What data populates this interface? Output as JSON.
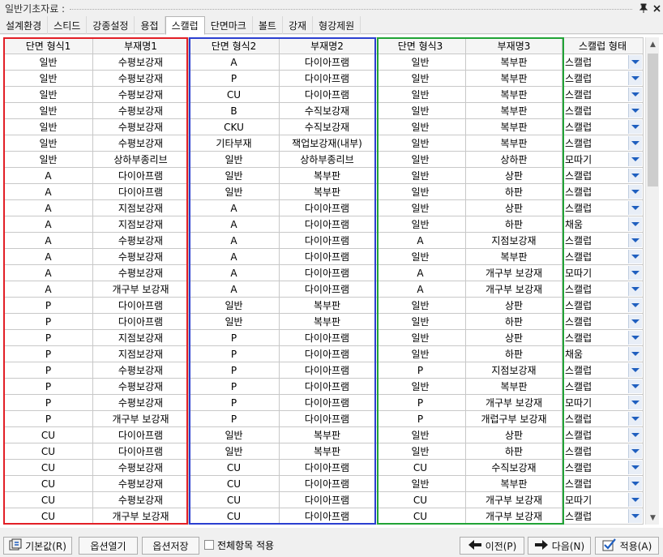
{
  "window": {
    "title": "일반기초자료 :"
  },
  "tabs": [
    "설계환경",
    "스티드",
    "강종설정",
    "용접",
    "스캘럽",
    "단면마크",
    "볼트",
    "강재",
    "형강제원"
  ],
  "active_tab_index": 4,
  "table": {
    "headers": [
      "단면 형식1",
      "부재명1",
      "단면 형식2",
      "부재명2",
      "단면 형식3",
      "부재명3",
      "스캘럽 형태"
    ],
    "rows": [
      [
        "일반",
        "수평보강재",
        "A",
        "다이아프램",
        "일반",
        "복부판",
        "스캘럽"
      ],
      [
        "일반",
        "수평보강재",
        "P",
        "다이아프램",
        "일반",
        "복부판",
        "스캘럽"
      ],
      [
        "일반",
        "수평보강재",
        "CU",
        "다이아프램",
        "일반",
        "복부판",
        "스캘럽"
      ],
      [
        "일반",
        "수평보강재",
        "B",
        "수직보강재",
        "일반",
        "복부판",
        "스캘럽"
      ],
      [
        "일반",
        "수평보강재",
        "CKU",
        "수직보강재",
        "일반",
        "복부판",
        "스캘럽"
      ],
      [
        "일반",
        "수평보강재",
        "기타부재",
        "잭업보강재(내부)",
        "일반",
        "복부판",
        "스캘럽"
      ],
      [
        "일반",
        "상하부종리브",
        "일반",
        "상하부종리브",
        "일반",
        "상하판",
        "모따기"
      ],
      [
        "A",
        "다이아프램",
        "일반",
        "복부판",
        "일반",
        "상판",
        "스캘럽"
      ],
      [
        "A",
        "다이아프램",
        "일반",
        "복부판",
        "일반",
        "하판",
        "스캘럽"
      ],
      [
        "A",
        "지점보강재",
        "A",
        "다이아프램",
        "일반",
        "상판",
        "스캘럽"
      ],
      [
        "A",
        "지점보강재",
        "A",
        "다이아프램",
        "일반",
        "하판",
        "채움"
      ],
      [
        "A",
        "수평보강재",
        "A",
        "다이아프램",
        "A",
        "지점보강재",
        "스캘럽"
      ],
      [
        "A",
        "수평보강재",
        "A",
        "다이아프램",
        "일반",
        "복부판",
        "스캘럽"
      ],
      [
        "A",
        "수평보강재",
        "A",
        "다이아프램",
        "A",
        "개구부 보강재",
        "모따기"
      ],
      [
        "A",
        "개구부 보강재",
        "A",
        "다이아프램",
        "A",
        "개구부 보강재",
        "스캘럽"
      ],
      [
        "P",
        "다이아프램",
        "일반",
        "복부판",
        "일반",
        "상판",
        "스캘럽"
      ],
      [
        "P",
        "다이아프램",
        "일반",
        "복부판",
        "일반",
        "하판",
        "스캘럽"
      ],
      [
        "P",
        "지점보강재",
        "P",
        "다이아프램",
        "일반",
        "상판",
        "스캘럽"
      ],
      [
        "P",
        "지점보강재",
        "P",
        "다이아프램",
        "일반",
        "하판",
        "채움"
      ],
      [
        "P",
        "수평보강재",
        "P",
        "다이아프램",
        "P",
        "지점보강재",
        "스캘럽"
      ],
      [
        "P",
        "수평보강재",
        "P",
        "다이아프램",
        "일반",
        "복부판",
        "스캘럽"
      ],
      [
        "P",
        "수평보강재",
        "P",
        "다이아프램",
        "P",
        "개구부 보강재",
        "모따기"
      ],
      [
        "P",
        "개구부 보강재",
        "P",
        "다이아프램",
        "P",
        "개럽구부 보강재",
        "스캘럽"
      ],
      [
        "CU",
        "다이아프램",
        "일반",
        "복부판",
        "일반",
        "상판",
        "스캘럽"
      ],
      [
        "CU",
        "다이아프램",
        "일반",
        "복부판",
        "일반",
        "하판",
        "스캘럽"
      ],
      [
        "CU",
        "수평보강재",
        "CU",
        "다이아프램",
        "CU",
        "수직보강재",
        "스캘럽"
      ],
      [
        "CU",
        "수평보강재",
        "CU",
        "다이아프램",
        "일반",
        "복부판",
        "스캘럽"
      ],
      [
        "CU",
        "수평보강재",
        "CU",
        "다이아프램",
        "CU",
        "개구부 보강재",
        "모따기"
      ],
      [
        "CU",
        "개구부 보강재",
        "CU",
        "다이아프램",
        "CU",
        "개구부 보강재",
        "스캘럽"
      ]
    ]
  },
  "buttons": {
    "default": "기본값(R)",
    "open_options": "옵션열기",
    "save_options": "옵션저장",
    "apply_all_label": "전체항목 적용",
    "prev": "이전(P)",
    "next": "다음(N)",
    "apply": "적용(A)"
  },
  "icons": {
    "title_pin": "pin-icon",
    "title_close": "close-icon",
    "default_button": "reset-icon",
    "prev_button": "arrow-left-icon",
    "next_button": "arrow-right-icon",
    "apply_button": "check-icon",
    "dropdown": "chevron-down-icon"
  },
  "colors": {
    "group1_border": "#e21f26",
    "group2_border": "#2b3fd0",
    "group3_border": "#21a336",
    "dropdown_arrow": "#1f5fbf"
  }
}
